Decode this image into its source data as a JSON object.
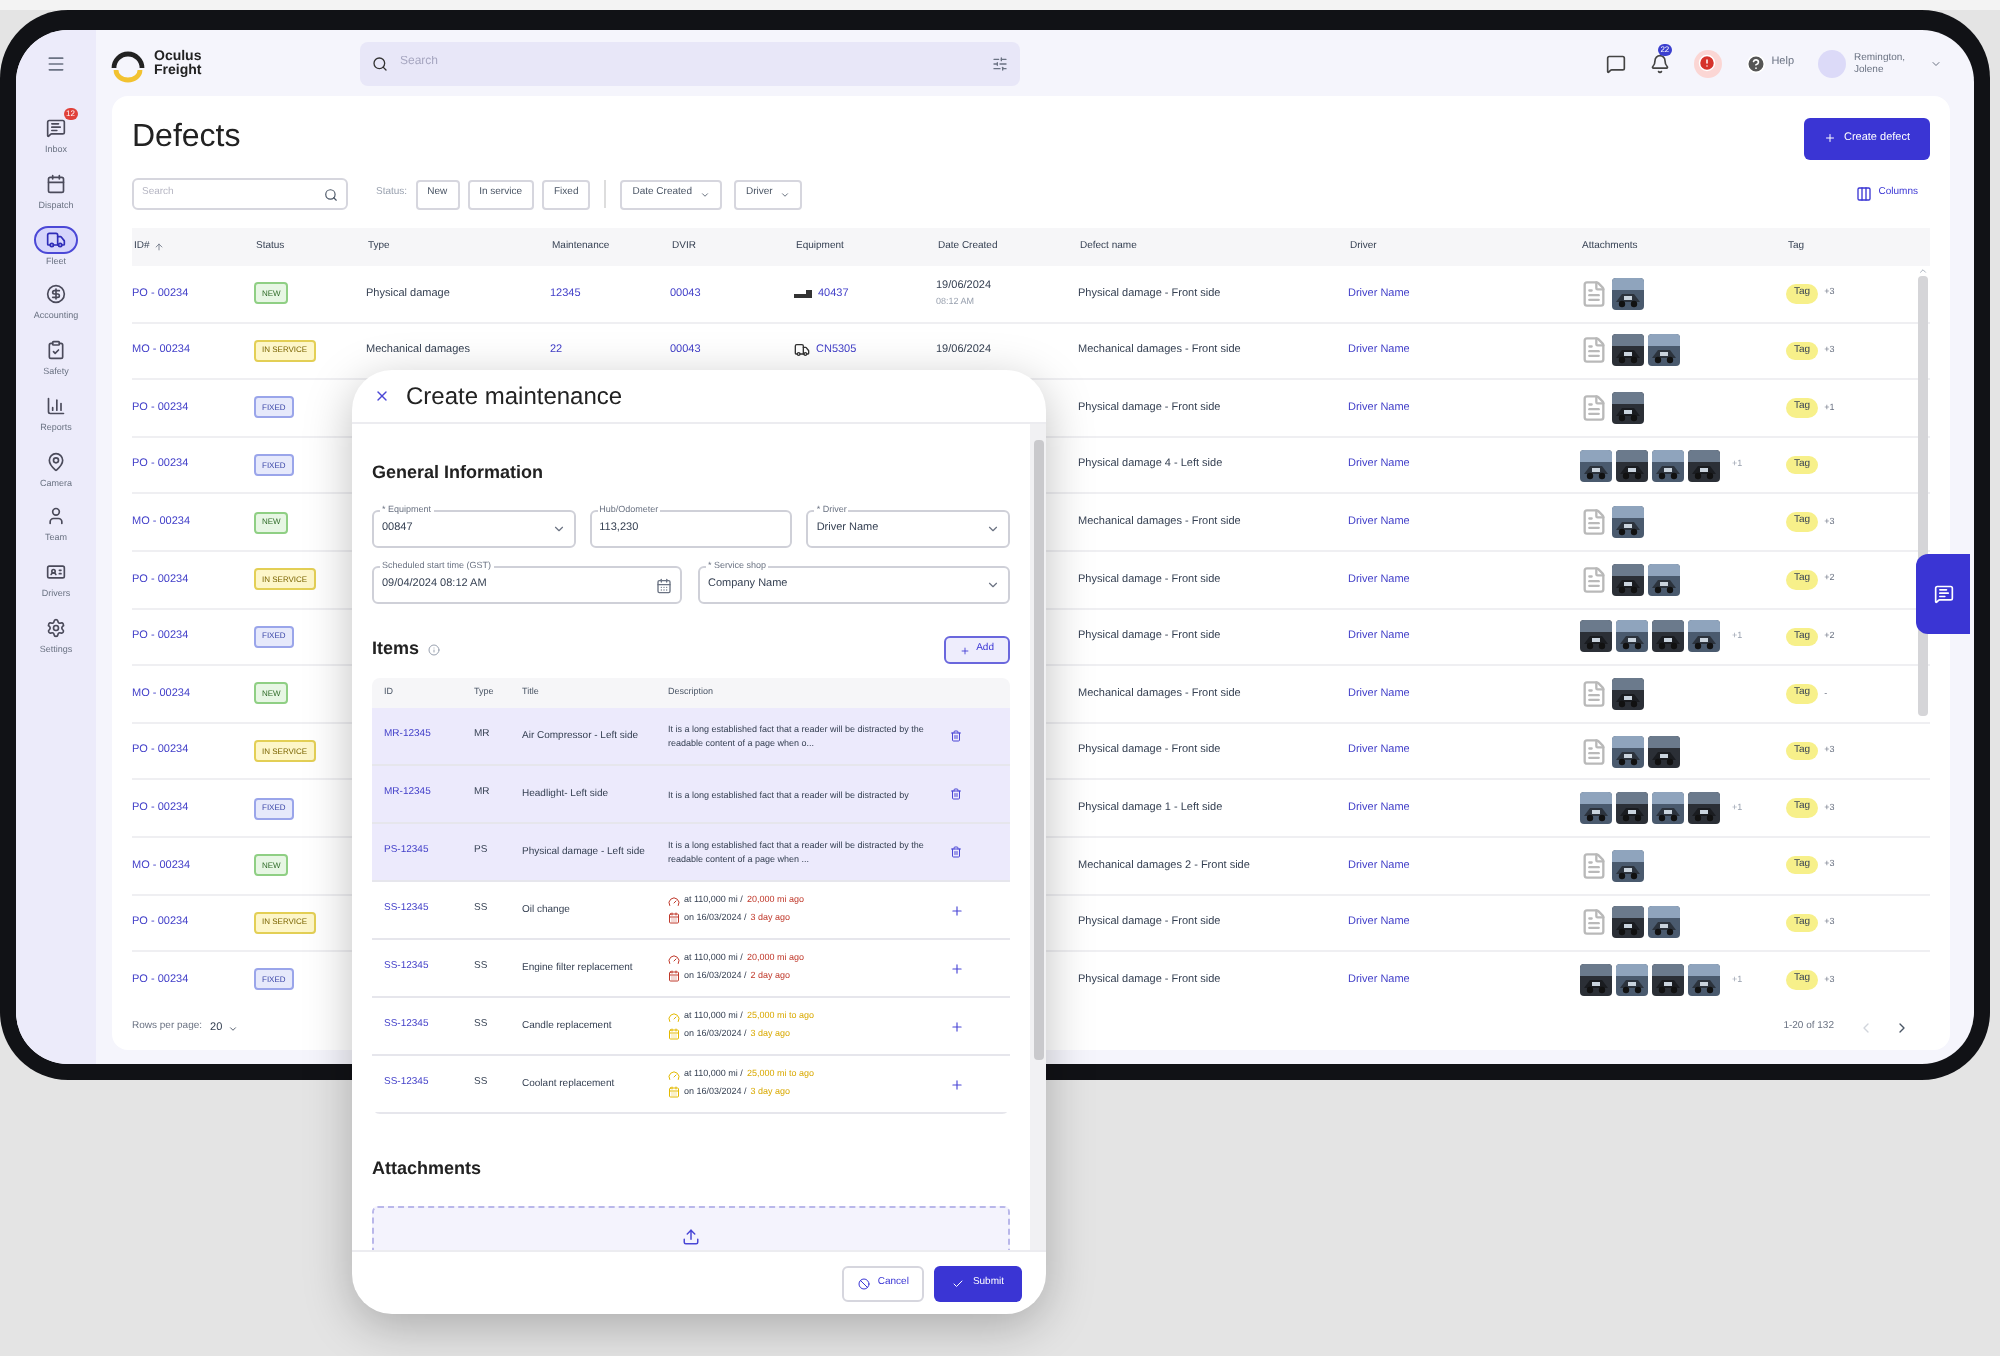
{
  "app": {
    "logo_line1": "Oculus",
    "logo_line2": "Freight",
    "search_placeholder": "Search",
    "bell_badge": "22",
    "help": "Help",
    "user": "Remington, Jolene"
  },
  "sidebar": {
    "items": [
      {
        "label": "Inbox",
        "selected": false,
        "badge": "12"
      },
      {
        "label": "Dispatch",
        "selected": false
      },
      {
        "label": "Fleet",
        "selected": true
      },
      {
        "label": "Accounting",
        "selected": false
      },
      {
        "label": "Safety",
        "selected": false
      },
      {
        "label": "Reports",
        "selected": false
      },
      {
        "label": "Camera",
        "selected": false
      },
      {
        "label": "Team",
        "selected": false
      },
      {
        "label": "Drivers",
        "selected": false
      },
      {
        "label": "Settings",
        "selected": false
      }
    ]
  },
  "page": {
    "title": "Defects",
    "create_button": "Create defect",
    "search_placeholder": "Search",
    "status_label": "Status:",
    "status_filters": [
      {
        "label": "New",
        "selected": false
      },
      {
        "label": "In service",
        "selected": false
      },
      {
        "label": "Fixed",
        "selected": false
      }
    ],
    "dropdowns": [
      "Date Created",
      "Driver"
    ],
    "columns_button": "Columns"
  },
  "table": {
    "columns": [
      "ID#",
      "Status",
      "Type",
      "Maintenance",
      "DVIR",
      "Equipment",
      "Date Created",
      "Defect name",
      "Driver",
      "Attachments",
      "Tag"
    ],
    "rows": [
      {
        "id": "PO - 00234",
        "status": "NEW",
        "type": "Physical damage",
        "maintenance": "12345",
        "dvir": "00043",
        "equipment": {
          "kind": "trailer",
          "label": "40437"
        },
        "date": "19/06/2024",
        "time": "08:12 AM",
        "defect": "Physical damage - Front side",
        "driver": "Driver Name",
        "attachments": [
          {
            "kind": "document"
          },
          {
            "kind": "picture"
          }
        ],
        "tag": "Tag",
        "tag_more": "+3"
      },
      {
        "id": "MO - 00234",
        "status": "IN SERVICE",
        "type": "Mechanical damages",
        "maintenance": "22",
        "dvir": "00043",
        "equipment": {
          "kind": "truck",
          "label": "CN5305"
        },
        "date": "19/06/2024",
        "defect": "Mechanical damages - Front side",
        "driver": "Driver Name",
        "attachments": [
          {
            "kind": "document"
          },
          {
            "kind": "picture"
          },
          {
            "kind": "picture"
          }
        ],
        "tag": "Tag",
        "tag_more": "+3"
      },
      {
        "id": "PO - 00234",
        "status": "FIXED",
        "defect": "Physical damage - Front side",
        "driver": "Driver Name",
        "attachments": [
          {
            "kind": "document"
          },
          {
            "kind": "picture"
          }
        ],
        "tag": "Tag",
        "tag_more": "+1"
      },
      {
        "id": "PO - 00234",
        "status": "FIXED",
        "defect": "Physical damage 4 - Left side",
        "driver": "Driver Name",
        "attachments": [
          {
            "kind": "picture"
          },
          {
            "kind": "picture"
          },
          {
            "kind": "picture"
          },
          {
            "kind": "picture"
          }
        ],
        "attachments_more": "+1",
        "tag": "Tag"
      },
      {
        "id": "MO - 00234",
        "status": "NEW",
        "defect": "Mechanical damages - Front side",
        "driver": "Driver Name",
        "attachments": [
          {
            "kind": "document"
          },
          {
            "kind": "picture"
          }
        ],
        "tag": "Tag",
        "tag_more": "+3"
      },
      {
        "id": "PO - 00234",
        "status": "IN SERVICE",
        "defect": "Physical damage - Front side",
        "driver": "Driver Name",
        "attachments": [
          {
            "kind": "document"
          },
          {
            "kind": "picture"
          },
          {
            "kind": "picture"
          }
        ],
        "tag": "Tag",
        "tag_more": "+2"
      },
      {
        "id": "PO - 00234",
        "status": "FIXED",
        "defect": "Physical damage - Front side",
        "driver": "Driver Name",
        "attachments": [
          {
            "kind": "picture"
          },
          {
            "kind": "picture"
          },
          {
            "kind": "picture"
          },
          {
            "kind": "picture"
          }
        ],
        "attachments_more": "+1",
        "tag": "Tag",
        "tag_more": "+2"
      },
      {
        "id": "MO - 00234",
        "status": "NEW",
        "defect": "Mechanical damages - Front side",
        "driver": "Driver Name",
        "attachments": [
          {
            "kind": "document"
          },
          {
            "kind": "picture"
          }
        ],
        "tag": "Tag",
        "tag_more": "-"
      },
      {
        "id": "PO - 00234",
        "status": "IN SERVICE",
        "defect": "Physical damage - Front side",
        "driver": "Driver Name",
        "attachments": [
          {
            "kind": "document"
          },
          {
            "kind": "picture"
          },
          {
            "kind": "picture"
          }
        ],
        "tag": "Tag",
        "tag_more": "+3"
      },
      {
        "id": "PO - 00234",
        "status": "FIXED",
        "defect": "Physical damage 1 - Left side",
        "driver": "Driver Name",
        "attachments": [
          {
            "kind": "picture"
          },
          {
            "kind": "picture"
          },
          {
            "kind": "picture"
          },
          {
            "kind": "picture"
          }
        ],
        "attachments_more": "+1",
        "tag": "Tag",
        "tag_more": "+3"
      },
      {
        "id": "MO - 00234",
        "status": "NEW",
        "defect": "Mechanical damages 2 - Front side",
        "driver": "Driver Name",
        "attachments": [
          {
            "kind": "document"
          },
          {
            "kind": "picture"
          }
        ],
        "tag": "Tag",
        "tag_more": "+3"
      },
      {
        "id": "PO - 00234",
        "status": "IN SERVICE",
        "defect": "Physical damage - Front side",
        "driver": "Driver Name",
        "attachments": [
          {
            "kind": "document"
          },
          {
            "kind": "picture"
          },
          {
            "kind": "picture"
          }
        ],
        "tag": "Tag",
        "tag_more": "+3"
      },
      {
        "id": "PO - 00234",
        "status": "FIXED",
        "defect": "Physical damage - Front side",
        "driver": "Driver Name",
        "attachments": [
          {
            "kind": "picture"
          },
          {
            "kind": "picture"
          },
          {
            "kind": "picture"
          },
          {
            "kind": "picture"
          }
        ],
        "attachments_more": "+1",
        "tag": "Tag",
        "tag_more": "+3"
      }
    ],
    "footer": {
      "rows_per_page_label": "Rows per page:",
      "rows_per_page": "20",
      "range": "1-20 of 132"
    }
  },
  "modal": {
    "title": "Create maintenance",
    "general_heading": "General Information",
    "fields": [
      {
        "label": "* Equipment",
        "value": "00847",
        "kind": "select"
      },
      {
        "label": "Hub/Odometer",
        "value": "113,230",
        "kind": "text"
      },
      {
        "label": "* Driver",
        "value": "Driver Name",
        "kind": "select"
      },
      {
        "label": "Scheduled start time (GST)",
        "value": "09/04/2024 08:12 AM",
        "kind": "date"
      },
      {
        "label": "* Service shop",
        "value": "Company Name",
        "kind": "select"
      }
    ],
    "items_heading": "Items",
    "add_button": "Add",
    "item_columns": [
      "ID",
      "Type",
      "Title",
      "Description"
    ],
    "items": [
      {
        "kind": "defect",
        "selected": true,
        "id": "MR-12345",
        "type": "MR",
        "title": "Air Compressor - Left side",
        "description": "It is a long established fact that a reader will be distracted by the readable content of a page when o..."
      },
      {
        "kind": "defect",
        "selected": true,
        "id": "MR-12345",
        "type": "MR",
        "title": "Headlight- Left side",
        "description": "It is a long established fact that a reader will be distracted by"
      },
      {
        "kind": "defect",
        "selected": true,
        "id": "PS-12345",
        "type": "PS",
        "title": "Physical damage - Left side",
        "description": "It is a long established fact that a reader will be distracted by the readable content of a page when ..."
      },
      {
        "kind": "service",
        "selected": false,
        "id": "SS-12345",
        "type": "SS",
        "title": "Oil change",
        "overdue": true,
        "mileage": "at 110,000 mi /",
        "mileage_note": "20,000 mi ago",
        "date": "on 16/03/2024 /",
        "date_note": "3 day ago"
      },
      {
        "kind": "service",
        "selected": false,
        "id": "SS-12345",
        "type": "SS",
        "title": "Engine filter replacement",
        "overdue": true,
        "mileage": "at 110,000 mi /",
        "mileage_note": "20,000 mi ago",
        "date": "on 16/03/2024 /",
        "date_note": "2 day ago"
      },
      {
        "kind": "service",
        "selected": false,
        "id": "SS-12345",
        "type": "SS",
        "title": "Candle replacement",
        "overdue": false,
        "mileage": "at 110,000 mi /",
        "mileage_note": "25,000 mi to ago",
        "date": "on 16/03/2024 /",
        "date_note": "3 day ago"
      },
      {
        "kind": "service",
        "selected": false,
        "id": "SS-12345",
        "type": "SS",
        "title": "Coolant replacement",
        "overdue": false,
        "mileage": "at 110,000 mi /",
        "mileage_note": "25,000 mi to ago",
        "date": "on 16/03/2024 /",
        "date_note": "3 day ago"
      }
    ],
    "attachments_heading": "Attachments",
    "cancel_button": "Cancel",
    "submit_button": "Submit"
  }
}
